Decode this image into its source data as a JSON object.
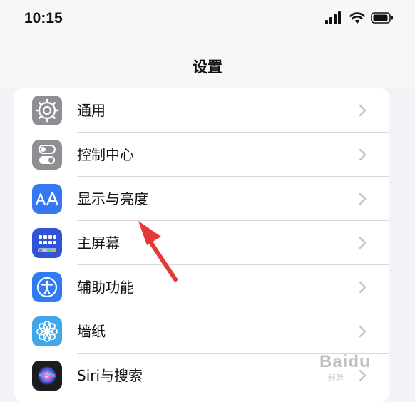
{
  "status_bar": {
    "time": "10:15"
  },
  "nav": {
    "title": "设置"
  },
  "settings_items": [
    {
      "label": "通用",
      "icon": "gear-icon",
      "icon_color": "#8e8e93"
    },
    {
      "label": "控制中心",
      "icon": "toggles-icon",
      "icon_color": "#8e8e93"
    },
    {
      "label": "显示与亮度",
      "icon": "text-size-icon",
      "icon_color": "#3478f6"
    },
    {
      "label": "主屏幕",
      "icon": "home-grid-icon",
      "icon_color": "#2f54d8"
    },
    {
      "label": "辅助功能",
      "icon": "accessibility-icon",
      "icon_color": "#2f7af5"
    },
    {
      "label": "墙纸",
      "icon": "flower-icon",
      "icon_color": "#40a7e8"
    },
    {
      "label": "Siri与搜索",
      "icon": "siri-icon",
      "icon_color": "#1c1c1e"
    }
  ],
  "watermark": {
    "text": "Baidu",
    "sub": "经验"
  },
  "annotation": {
    "arrow_color": "#e53935",
    "points_to": "显示与亮度"
  }
}
